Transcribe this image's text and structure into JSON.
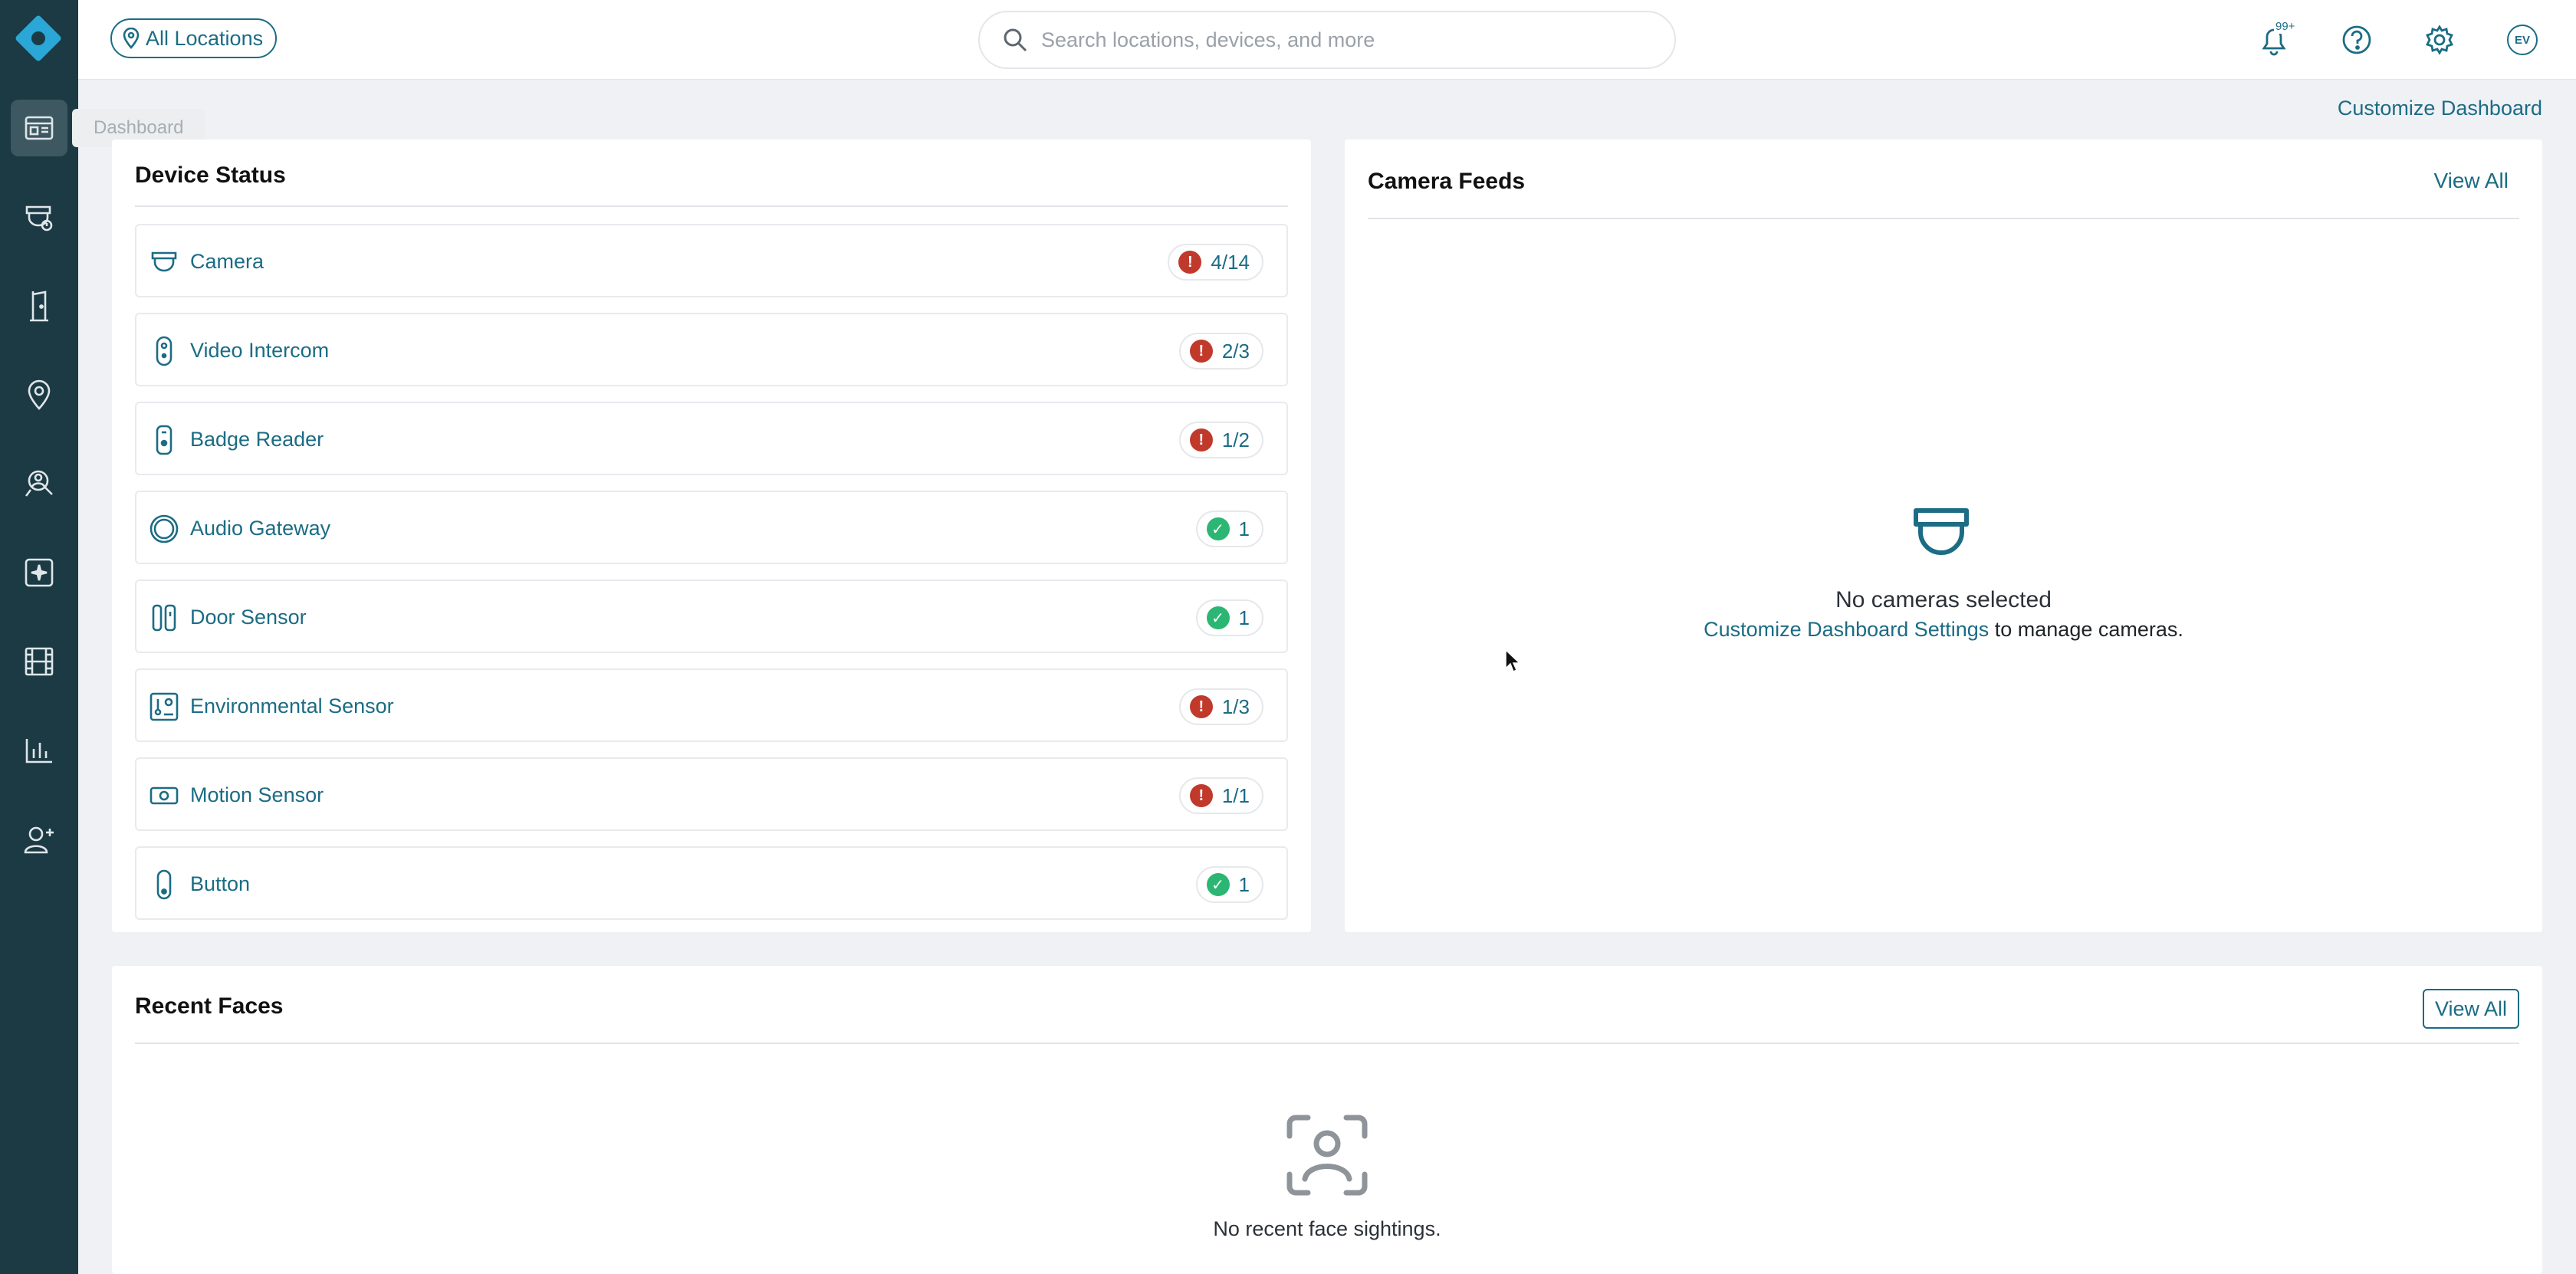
{
  "sidebar": {
    "logo": "product-logo",
    "tooltip": "Dashboard",
    "items": [
      {
        "icon": "dashboard-icon",
        "active": true
      },
      {
        "icon": "camera-icon",
        "active": false
      },
      {
        "icon": "door-icon",
        "active": false
      },
      {
        "icon": "location-pin-icon",
        "active": false
      },
      {
        "icon": "person-search-icon",
        "active": false
      },
      {
        "icon": "alarm-panel-icon",
        "active": false
      },
      {
        "icon": "film-icon",
        "active": false
      },
      {
        "icon": "bar-chart-icon",
        "active": false
      },
      {
        "icon": "add-user-icon",
        "active": false
      }
    ]
  },
  "topbar": {
    "location_label": "All Locations",
    "search_placeholder": "Search locations, devices, and more",
    "notifications_badge": "99+",
    "avatar_initials": "EV"
  },
  "customize_dashboard": "Customize Dashboard",
  "device_status": {
    "title": "Device Status",
    "rows": [
      {
        "label": "Camera",
        "status": "error",
        "count": "4/14"
      },
      {
        "label": "Video Intercom",
        "status": "error",
        "count": "2/3"
      },
      {
        "label": "Badge Reader",
        "status": "error",
        "count": "1/2"
      },
      {
        "label": "Audio Gateway",
        "status": "ok",
        "count": "1"
      },
      {
        "label": "Door Sensor",
        "status": "ok",
        "count": "1"
      },
      {
        "label": "Environmental Sensor",
        "status": "error",
        "count": "1/3"
      },
      {
        "label": "Motion Sensor",
        "status": "error",
        "count": "1/1"
      },
      {
        "label": "Button",
        "status": "ok",
        "count": "1"
      }
    ]
  },
  "camera_feeds": {
    "title": "Camera Feeds",
    "view_all": "View All",
    "empty_title": "No cameras selected",
    "empty_link": "Customize Dashboard Settings",
    "empty_rest": " to manage cameras."
  },
  "recent_faces": {
    "title": "Recent Faces",
    "view_all": "View All",
    "empty_text": "No recent face sightings."
  },
  "colors": {
    "sidebar_bg": "#1c3a44",
    "accent": "#1b6c84",
    "error": "#c0392b",
    "ok": "#2bb673",
    "page_bg": "#eff1f5"
  }
}
